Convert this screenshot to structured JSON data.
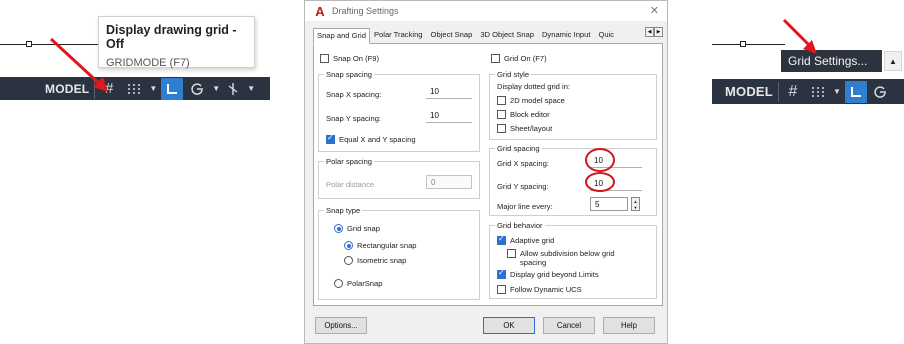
{
  "left": {
    "tooltip_title": "Display drawing grid - Off",
    "tooltip_command": "GRIDMODE (F7)",
    "status_label": "MODEL"
  },
  "dialog": {
    "title": "Drafting Settings",
    "tabs": [
      "Snap and Grid",
      "Polar Tracking",
      "Object Snap",
      "3D Object Snap",
      "Dynamic Input",
      "Quic"
    ],
    "snap_on_label": "Snap On (F9)",
    "snap_on_checked": false,
    "grid_on_label": "Grid On (F7)",
    "grid_on_checked": false,
    "snap_spacing": {
      "title": "Snap spacing",
      "x_label": "Snap X spacing:",
      "x_value": "10",
      "y_label": "Snap Y spacing:",
      "y_value": "10",
      "equal_label": "Equal X and Y spacing",
      "equal_checked": true
    },
    "polar_spacing": {
      "title": "Polar spacing",
      "distance_label": "Polar distance",
      "distance_value": "0"
    },
    "snap_type": {
      "title": "Snap type",
      "grid_snap": "Grid snap",
      "rectangular": "Rectangular snap",
      "isometric": "Isometric snap",
      "polar": "PolarSnap",
      "selected": "Grid snap",
      "grid_subtype": "Rectangular snap"
    },
    "grid_style": {
      "title": "Grid style",
      "caption": "Display dotted grid in:",
      "model_space": "2D model space",
      "block_editor": "Block editor",
      "sheet_layout": "Sheet/layout"
    },
    "grid_spacing": {
      "title": "Grid spacing",
      "x_label": "Grid X spacing:",
      "x_value": "10",
      "y_label": "Grid Y spacing:",
      "y_value": "10",
      "major_label": "Major line every:",
      "major_value": "5"
    },
    "grid_behavior": {
      "title": "Grid behavior",
      "adaptive": "Adaptive grid",
      "adaptive_checked": true,
      "subdivision": "Allow subdivision below grid",
      "subdivision_2": "spacing",
      "subdivision_checked": false,
      "beyond_limits": "Display grid beyond Limits",
      "beyond_limits_checked": true,
      "follow_ucs": "Follow Dynamic UCS",
      "follow_ucs_checked": false
    },
    "buttons": {
      "options": "Options...",
      "ok": "OK",
      "cancel": "Cancel",
      "help": "Help"
    }
  },
  "right": {
    "tooltip": "Grid Settings...",
    "status_label": "MODEL"
  },
  "colors": {
    "statusbar_bg": "#2b3340",
    "active_blue": "#2f7fd0",
    "annotation_red": "#d0161c"
  },
  "icons": [
    "grid-icon",
    "dotted-grid-icon",
    "dropdown-arrow-icon",
    "ortho-icon",
    "polar-tracking-icon",
    "isodraft-icon",
    "close-icon",
    "up-arrow-icon"
  ]
}
